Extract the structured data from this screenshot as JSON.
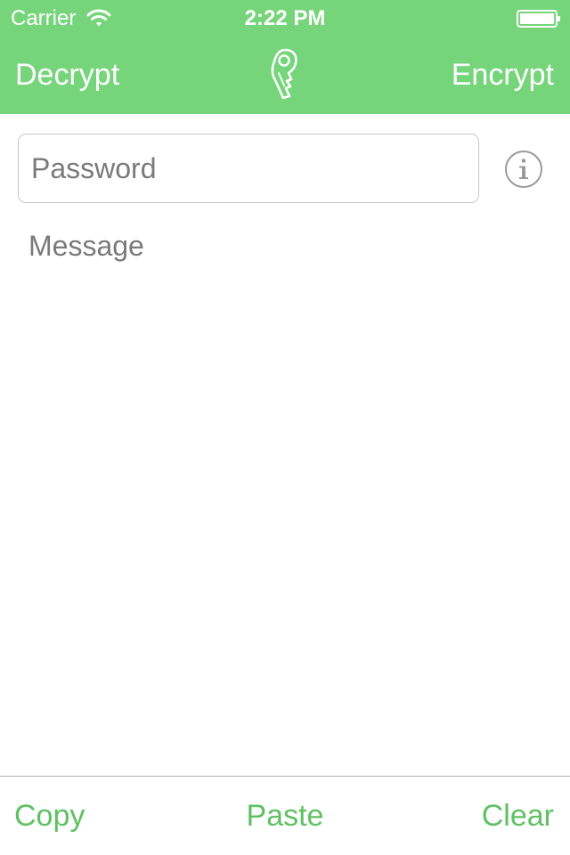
{
  "status_bar": {
    "carrier": "Carrier",
    "time": "2:22 PM",
    "wifi_icon": "wifi-icon",
    "battery_icon": "battery-icon"
  },
  "nav_bar": {
    "left_label": "Decrypt",
    "right_label": "Encrypt",
    "logo_icon": "key-logo-icon"
  },
  "form": {
    "password_placeholder": "Password",
    "password_value": "",
    "message_placeholder": "Message",
    "message_value": "",
    "info_icon": "info-icon"
  },
  "toolbar": {
    "copy_label": "Copy",
    "paste_label": "Paste",
    "clear_label": "Clear"
  },
  "colors": {
    "header_bg": "#76d57a",
    "accent": "#5fc163",
    "placeholder": "#7a7a7a",
    "border": "#c8c8c8"
  }
}
